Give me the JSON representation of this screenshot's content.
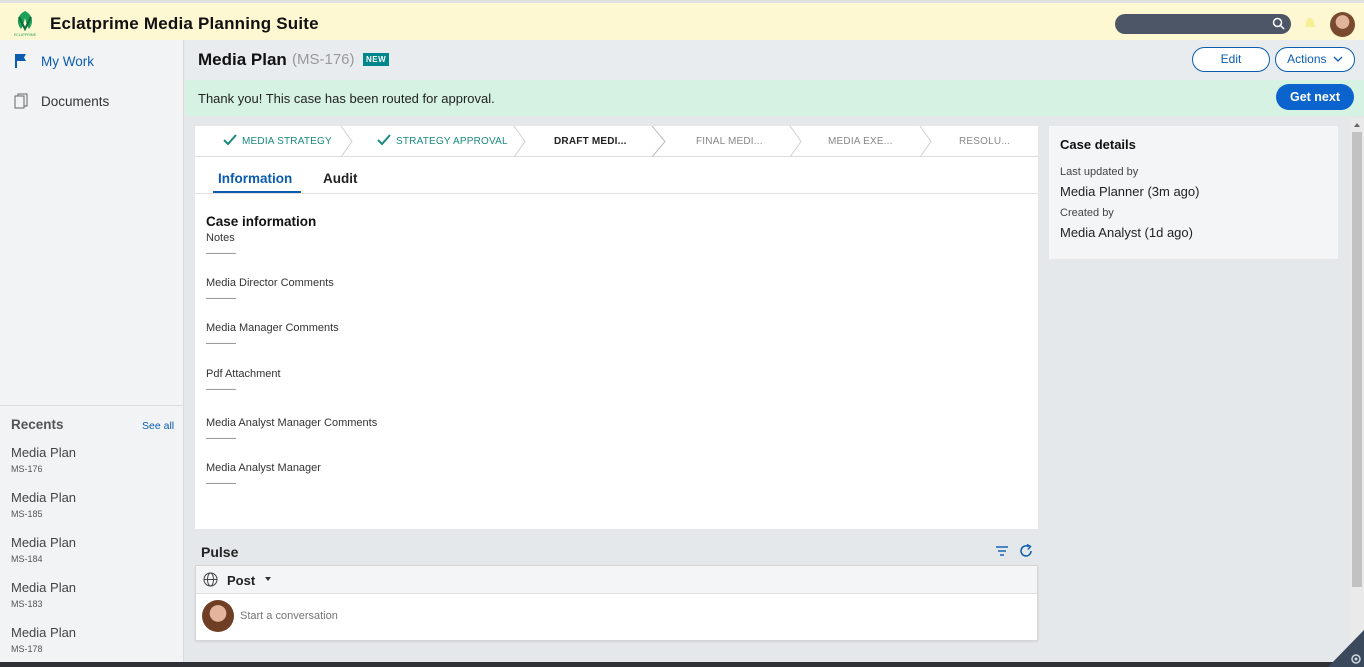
{
  "app": {
    "title": "Eclatprime Media Planning Suite",
    "logo_text": "ECLATPRIME"
  },
  "topbar": {
    "search_placeholder": ""
  },
  "sidebar": {
    "items": [
      {
        "label": "My Work",
        "icon": "flag-icon"
      },
      {
        "label": "Documents",
        "icon": "document-icon"
      }
    ],
    "recents_title": "Recents",
    "see_all": "See all",
    "recents": [
      {
        "title": "Media Plan",
        "id": "MS-176"
      },
      {
        "title": "Media Plan",
        "id": "MS-185"
      },
      {
        "title": "Media Plan",
        "id": "MS-184"
      },
      {
        "title": "Media Plan",
        "id": "MS-183"
      },
      {
        "title": "Media Plan",
        "id": "MS-178"
      }
    ]
  },
  "case": {
    "title": "Media Plan",
    "id": "(MS-176)",
    "badge": "NEW",
    "edit_label": "Edit",
    "actions_label": "Actions"
  },
  "banner": {
    "message": "Thank you! This case has been routed for approval.",
    "get_next_label": "Get next"
  },
  "stages": [
    {
      "label": "MEDIA STRATEGY",
      "status": "done"
    },
    {
      "label": "STRATEGY APPROVAL",
      "status": "done"
    },
    {
      "label": "DRAFT MEDI...",
      "status": "current"
    },
    {
      "label": "FINAL MEDI...",
      "status": "future"
    },
    {
      "label": "MEDIA EXE...",
      "status": "future"
    },
    {
      "label": "RESOLU...",
      "status": "future"
    }
  ],
  "tabs": [
    {
      "label": "Information",
      "active": true
    },
    {
      "label": "Audit",
      "active": false
    }
  ],
  "info": {
    "section_title": "Case information",
    "fields": [
      {
        "label": "Notes",
        "value": "———"
      },
      {
        "label": "Media Director Comments",
        "value": "———"
      },
      {
        "label": "Media Manager Comments",
        "value": "———"
      },
      {
        "label": "Pdf Attachment",
        "value": "———"
      },
      {
        "label": "Media Analyst Manager Comments",
        "value": "———"
      },
      {
        "label": "Media Analyst Manager",
        "value": "———"
      }
    ]
  },
  "details": {
    "title": "Case details",
    "last_updated_label": "Last updated by",
    "last_updated_value": "Media Planner (3m ago)",
    "created_label": "Created by",
    "created_value": "Media Analyst (1d ago)"
  },
  "pulse": {
    "title": "Pulse",
    "post_label": "Post",
    "placeholder": "Start a conversation"
  },
  "colors": {
    "topbar_bg": "#fdf8d1",
    "accent_blue": "#0b5cad",
    "primary_button": "#0b63ce",
    "banner_bg": "#d5f2e3",
    "stage_done": "#1a8a80",
    "badge_teal": "#00868b"
  }
}
